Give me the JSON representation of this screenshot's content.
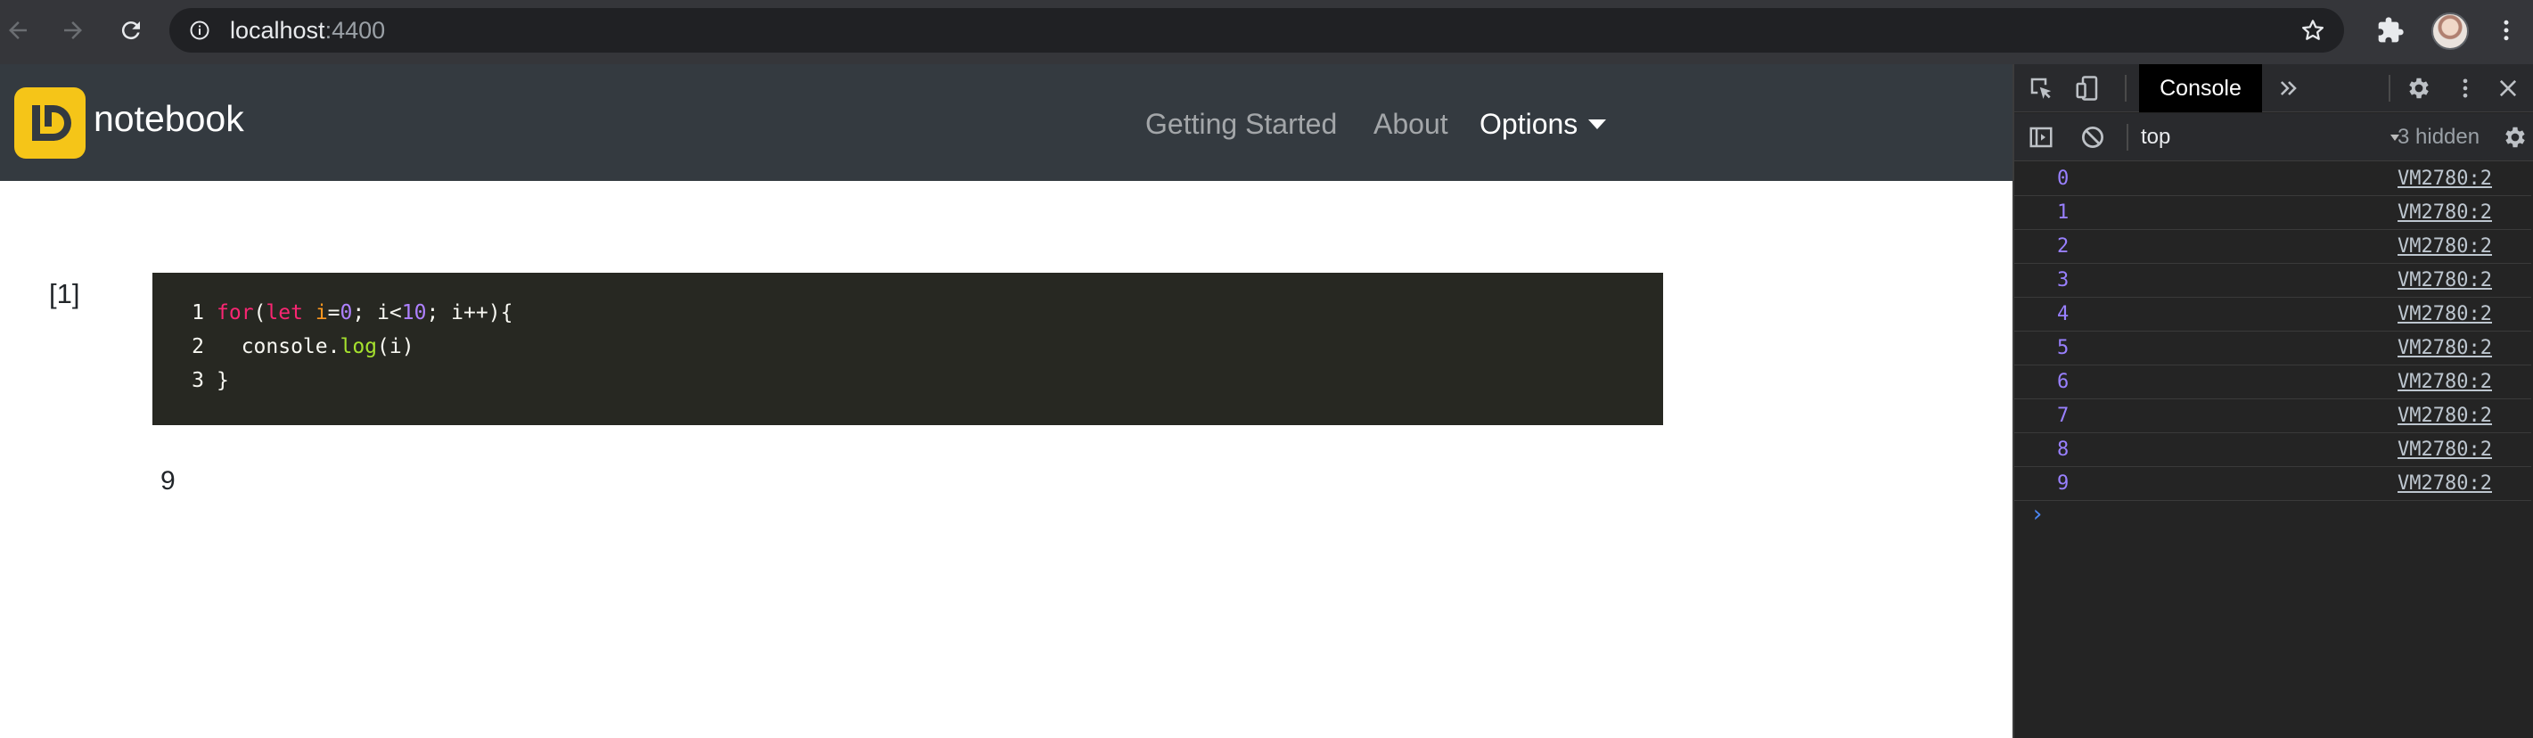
{
  "browser": {
    "url_host": "localhost",
    "url_port": ":4400",
    "icons": [
      "back-icon",
      "forward-icon",
      "reload-icon",
      "info-icon",
      "star-icon",
      "extensions-icon",
      "avatar",
      "kebab-menu-icon"
    ]
  },
  "app": {
    "brand": "notebook",
    "nav": {
      "getting_started": "Getting Started",
      "about": "About",
      "options": "Options"
    }
  },
  "cell": {
    "index": "[1]",
    "lines": [
      {
        "n": "1",
        "text": "for(let i=0; i<10; i++){"
      },
      {
        "n": "2",
        "text": "  console.log(i)"
      },
      {
        "n": "3",
        "text": "}"
      }
    ],
    "output": "9"
  },
  "devtools": {
    "tab": "Console",
    "context": "top",
    "hidden": "3 hidden",
    "logs": [
      {
        "value": "0",
        "source": "VM2780:2"
      },
      {
        "value": "1",
        "source": "VM2780:2"
      },
      {
        "value": "2",
        "source": "VM2780:2"
      },
      {
        "value": "3",
        "source": "VM2780:2"
      },
      {
        "value": "4",
        "source": "VM2780:2"
      },
      {
        "value": "5",
        "source": "VM2780:2"
      },
      {
        "value": "6",
        "source": "VM2780:2"
      },
      {
        "value": "7",
        "source": "VM2780:2"
      },
      {
        "value": "8",
        "source": "VM2780:2"
      },
      {
        "value": "9",
        "source": "VM2780:2"
      }
    ],
    "prompt": "›"
  },
  "colors": {
    "chrome_bg": "#35363a",
    "navbar_bg": "#343a40",
    "logo_yellow": "#f5c518",
    "code_bg": "#272822",
    "log_number": "#9980ff"
  }
}
